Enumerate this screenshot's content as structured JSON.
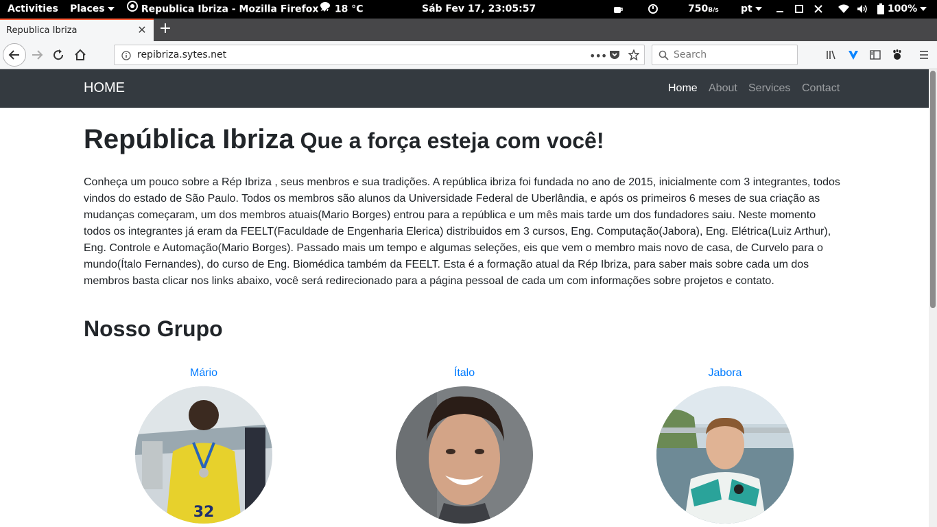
{
  "topbar": {
    "activities": "Activities",
    "places": "Places",
    "app": "Republica Ibriza - Mozilla Firefox",
    "weather": "18 °C",
    "clock": "Sáb Fev 17, 23:05:57",
    "net_speed": "750",
    "net_unit": "B/s",
    "lang": "pt",
    "battery": "100%"
  },
  "browser": {
    "tab_title": "Republica Ibriza",
    "url": "repibriza.sytes.net",
    "search_placeholder": "Search"
  },
  "site": {
    "brand": "HOME",
    "nav": [
      "Home",
      "About",
      "Services",
      "Contact"
    ],
    "heading": "República Ibriza",
    "subheading": "Que a força esteja com você!",
    "intro": "Conheça um pouco sobre a Rép Ibriza , seus menbros e sua tradições. A república ibriza foi fundada no ano de 2015, inicialmente com 3 integrantes, todos vindos do estado de São Paulo. Todos os membros são alunos da Universidade Federal de Uberlândia, e após os primeiros 6 meses de sua criação as mudanças começaram, um dos membros atuais(Mario Borges) entrou para a república e um mês mais tarde um dos fundadores saiu. Neste momento todos os integrantes já eram da FEELT(Faculdade de Engenharia Elerica) distribuidos em 3 cursos, Eng. Computação(Jabora), Eng. Elétrica(Luiz Arthur), Eng. Controle e Automação(Mario Borges). Passado mais um tempo e algumas seleções, eis que vem o membro mais novo de casa, de Curvelo para o mundo(Ítalo Fernandes), do curso de Eng. Biomédica também da FEELT. Esta é a formação atual da Rép Ibriza, para saber mais sobre cada um dos membros basta clicar nos links abaixo, você será redirecionado para a página pessoal de cada um com informações sobre projetos e contato.",
    "group_title": "Nosso Grupo",
    "members": [
      "Mário",
      "Ítalo",
      "Jabora"
    ]
  },
  "colors": {
    "site_nav_bg": "#343a40",
    "link": "#007bff",
    "tab_accent": "#ff5a36"
  }
}
